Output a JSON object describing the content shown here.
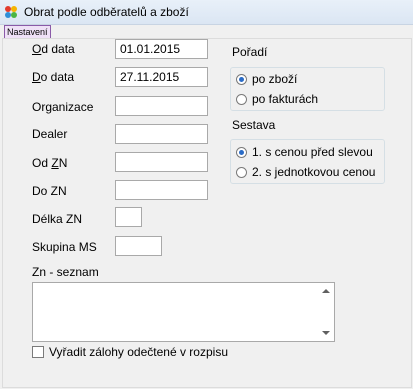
{
  "window": {
    "title": "Obrat podle odběratelů a zboží"
  },
  "menu": {
    "settings_label": "Nastavení"
  },
  "form": {
    "od_data": {
      "label_u": "O",
      "label_rest": "d data",
      "value": "01.01.2015"
    },
    "do_data": {
      "label_u": "D",
      "label_rest": "o data",
      "value": "27.11.2015"
    },
    "organizace": {
      "label": "Organizace",
      "value": ""
    },
    "dealer": {
      "label": "Dealer",
      "value": ""
    },
    "od_zn": {
      "label_pre": "Od ",
      "label_u": "Z",
      "label_rest": "N",
      "value": ""
    },
    "do_zn": {
      "label": "Do ZN",
      "value": ""
    },
    "delka_zn": {
      "label": "Délka ZN",
      "value": ""
    },
    "skupina_ms": {
      "label": "Skupina MS",
      "value": ""
    },
    "zn_seznam": {
      "label": "Zn - seznam",
      "value": ""
    },
    "vyradit": {
      "label": "Vyřadit zálohy odečtené v rozpisu",
      "checked": false
    }
  },
  "poradi": {
    "title": "Pořadí",
    "options": [
      "po zboží",
      "po fakturách"
    ],
    "selected": "po zboží"
  },
  "sestava": {
    "title": "Sestava",
    "options": [
      "1. s cenou před slevou",
      "2. s jednotkovou cenou"
    ],
    "selected": "1. s cenou před slevou"
  }
}
